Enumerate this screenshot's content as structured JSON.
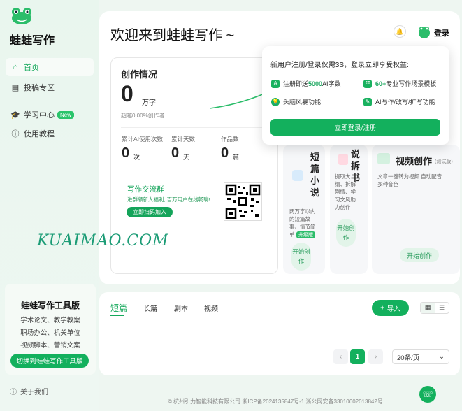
{
  "brand": {
    "name": "蛙蛙写作"
  },
  "nav": [
    {
      "label": "首页",
      "icon": "home-icon"
    },
    {
      "label": "投稿专区",
      "icon": "submit-icon"
    },
    {
      "label": "学习中心",
      "icon": "graduation-cap-icon",
      "badge": "New"
    },
    {
      "label": "使用教程",
      "icon": "info-icon"
    }
  ],
  "toolcard": {
    "title": "蛙蛙写作工具版",
    "lines": [
      "学术论文、教学教案",
      "职场办公、机关单位",
      "视频脚本、营销文案"
    ],
    "button": "切换到蛙蛙写作工具版"
  },
  "about": "关于我们",
  "header": {
    "welcome": "欢迎来到蛙蛙写作 ~",
    "login": "登录"
  },
  "stats": {
    "title": "创作情况",
    "total": "0",
    "total_unit": "万字",
    "beyond": "超越0.00%创作者",
    "items": [
      {
        "label": "累计AI使用次数",
        "value": "0",
        "unit": "次"
      },
      {
        "label": "累计天数",
        "value": "0",
        "unit": "天"
      },
      {
        "label": "作品数",
        "value": "0",
        "unit": "篇"
      }
    ]
  },
  "group": {
    "title": "写作交流群",
    "sub": "进群领新人福利, 百万用户在线畅聊!",
    "button": "立即扫码加入"
  },
  "watermark": "KUAIMAO.COM",
  "features": {
    "short": {
      "title": "短篇小说",
      "desc": "两万字以内的短篇故事、情节简单",
      "tag": "升级版",
      "button": "开始创作"
    },
    "book": {
      "title": "说拆书",
      "desc": "提取大纲、拆解剧情、学习文风助力创作",
      "button": "开始创作"
    },
    "video": {
      "title": "视频创作",
      "tag": "(测试版)",
      "desc": "文章一键转为视频 自动配音 多种音色",
      "button": "开始创作"
    }
  },
  "popup": {
    "heading": "新用户注册/登录仅需3S，登录立即享受权益:",
    "perks": [
      {
        "pre": "注册即送",
        "bold": "5000",
        "post": "AI字数",
        "icon": "letter-a-icon"
      },
      {
        "pre": "",
        "bold": "60+",
        "post": "专业写作场景模板",
        "icon": "checklist-icon"
      },
      {
        "pre": "头脑风暴功能",
        "bold": "",
        "post": "",
        "icon": "lightbulb-icon"
      },
      {
        "pre": "AI写作/改写/扩写功能",
        "bold": "",
        "post": "",
        "icon": "pen-icon"
      }
    ],
    "button": "立即登录/注册"
  },
  "works": {
    "tabs": [
      "短篇",
      "长篇",
      "剧本",
      "视频"
    ],
    "import": "导入",
    "page": "1",
    "page_size": "20条/页"
  },
  "footer": "© 杭州引力智能科技有限公司 浙ICP备2024135847号-1  浙公网安备33010602013842号"
}
